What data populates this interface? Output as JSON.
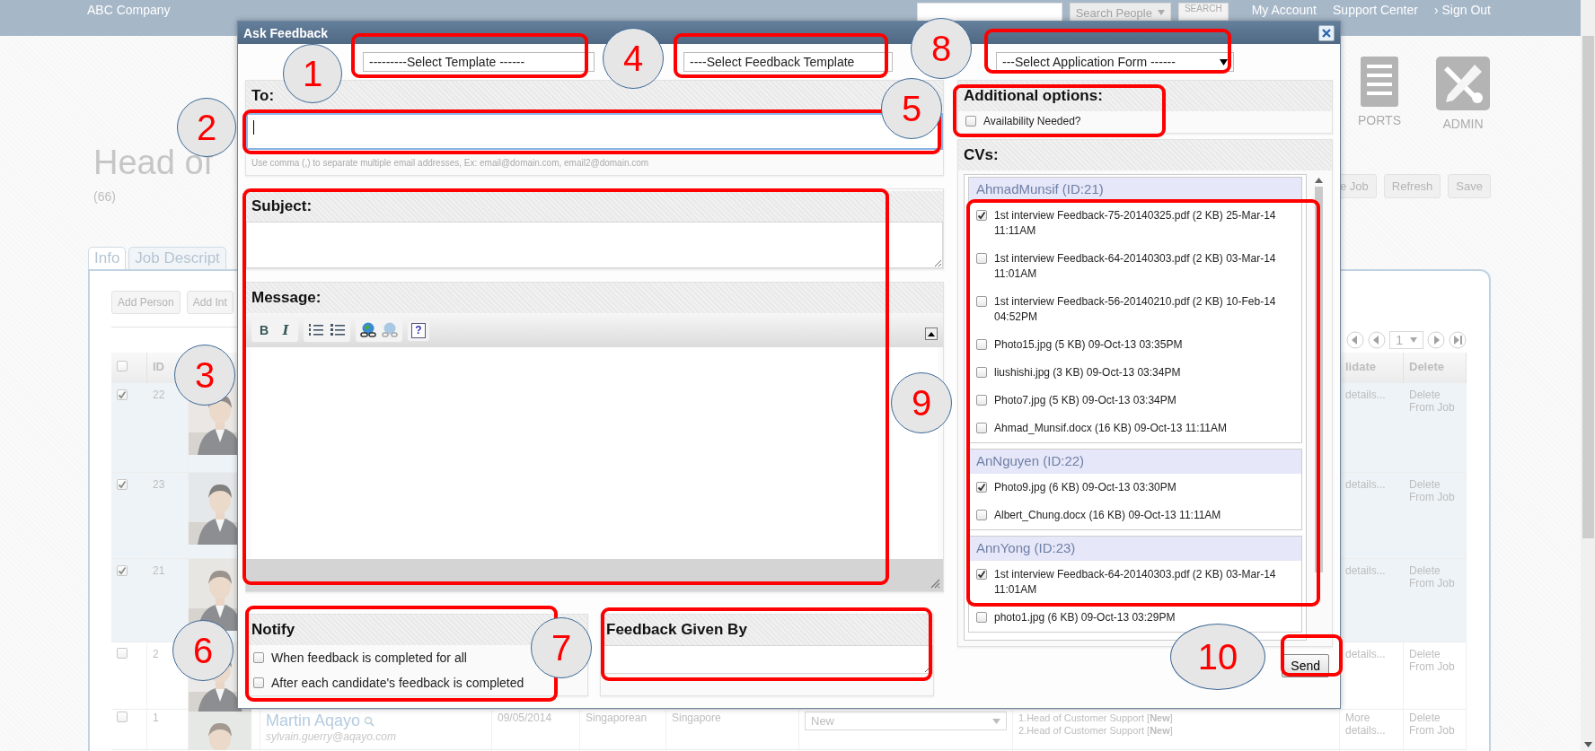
{
  "header": {
    "company": "ABC Company",
    "search_scope": "Search People",
    "search_button": "SEARCH",
    "links": [
      "My Account",
      "Support Center",
      "› Sign Out"
    ]
  },
  "nav_icons": [
    {
      "kind": "reports",
      "label": "PORTS"
    },
    {
      "kind": "admin",
      "label": "ADMIN"
    }
  ],
  "page": {
    "title": "Head of",
    "count": "(66)"
  },
  "action_buttons": [
    "e Job",
    "Refresh",
    "Save"
  ],
  "tabs": [
    {
      "label": "Info",
      "selected": true
    },
    {
      "label": "Job Descript",
      "selected": false
    }
  ],
  "toolbar_buttons": [
    "Add Person",
    "Add Int"
  ],
  "pager": {
    "page": "1"
  },
  "table": {
    "header_checked": false,
    "columns": {
      "id": "ID",
      "column_10": "lidate",
      "delete": "Delete"
    },
    "rows": [
      {
        "checked": true,
        "id": "22",
        "details": "details...",
        "delete": "Delete From Job"
      },
      {
        "checked": true,
        "id": "23",
        "details": "details...",
        "delete": "Delete From Job"
      },
      {
        "checked": true,
        "id": "21",
        "details": "details...",
        "delete": "Delete From Job"
      },
      {
        "checked": false,
        "id": "2",
        "details": "details...",
        "delete": "Delete From Job"
      },
      {
        "checked": false,
        "id": "1",
        "name": "Martin Aqayo",
        "email": "sylvain.guerry@aqayo.com",
        "date": "09/05/2014",
        "nationality": "Singaporean",
        "location": "Singapore",
        "status": "New",
        "jobs": [
          "1.Head of Customer Support [**New**]",
          "2.Head of Customer Support [**New**]"
        ],
        "details": "More details...",
        "delete": "Delete From Job"
      }
    ]
  },
  "dialog": {
    "title": "Ask Feedback",
    "selects": [
      {
        "value": "---------Select Template ------",
        "arrow": false
      },
      {
        "value": "----Select Feedback Template",
        "arrow": false
      },
      {
        "value": "---Select Application Form ------",
        "arrow": true
      }
    ],
    "to": {
      "label": "To:",
      "focused": true,
      "hint": "Use comma (,) to separate multiple email addresses, Ex: email@domain.com, email2@domain.com"
    },
    "subject": {
      "label": "Subject:"
    },
    "message": {
      "label": "Message:",
      "editor_toolbar": [
        [
          {
            "kind": "bold",
            "label": "B",
            "disabled": false
          },
          {
            "kind": "italic",
            "label": "I",
            "disabled": false
          }
        ],
        [
          {
            "kind": "ordered-list",
            "disabled": false
          },
          {
            "kind": "bullet-list",
            "disabled": false
          }
        ],
        [
          {
            "kind": "link",
            "disabled": false
          },
          {
            "kind": "unlink",
            "disabled": true
          }
        ],
        [
          {
            "kind": "help",
            "label": "?",
            "disabled": false
          }
        ]
      ]
    },
    "notify": {
      "title": "Notify",
      "options": [
        {
          "label": "When feedback is completed for all",
          "checked": false
        },
        {
          "label": "After each candidate's feedback is completed",
          "checked": false
        }
      ]
    },
    "feedback_given_by": {
      "title": "Feedback Given By"
    },
    "additional_options": {
      "title": "Additional options:",
      "options": [
        {
          "label": "Availability Needed?",
          "checked": false
        }
      ]
    },
    "cvs": {
      "title": "CVs:",
      "groups": [
        {
          "name": "AhmadMunsif (ID:21)",
          "files": [
            {
              "label": "1st interview Feedback-75-20140325.pdf (2 KB) 25-Mar-14 11:11AM",
              "checked": true
            },
            {
              "label": "1st interview Feedback-64-20140303.pdf (2 KB) 03-Mar-14 11:01AM",
              "checked": false
            },
            {
              "label": "1st interview Feedback-56-20140210.pdf (2 KB) 10-Feb-14 04:52PM",
              "checked": false
            },
            {
              "label": "Photo15.jpg (5 KB) 09-Oct-13 03:35PM",
              "checked": false
            },
            {
              "label": "liushishi.jpg (3 KB) 09-Oct-13 03:34PM",
              "checked": false
            },
            {
              "label": "Photo7.jpg (5 KB) 09-Oct-13 03:34PM",
              "checked": false
            },
            {
              "label": "Ahmad_Munsif.docx (16 KB) 09-Oct-13 11:11AM",
              "checked": false
            }
          ]
        },
        {
          "name": "AnNguyen (ID:22)",
          "files": [
            {
              "label": "Photo9.jpg (6 KB) 09-Oct-13 03:30PM",
              "checked": true
            },
            {
              "label": "Albert_Chung.docx (16 KB) 09-Oct-13 11:11AM",
              "checked": false
            }
          ]
        },
        {
          "name": "AnnYong (ID:23)",
          "files": [
            {
              "label": "1st interview Feedback-64-20140303.pdf (2 KB) 03-Mar-14 11:01AM",
              "checked": true
            },
            {
              "label": "photo1.jpg (6 KB) 09-Oct-13 03:29PM",
              "checked": false
            }
          ]
        }
      ]
    },
    "send_button": "Send"
  },
  "annotations": [
    {
      "number": "1"
    },
    {
      "number": "2"
    },
    {
      "number": "3"
    },
    {
      "number": "4"
    },
    {
      "number": "5"
    },
    {
      "number": "6"
    },
    {
      "number": "7"
    },
    {
      "number": "8"
    },
    {
      "number": "9"
    },
    {
      "number": "10"
    }
  ]
}
